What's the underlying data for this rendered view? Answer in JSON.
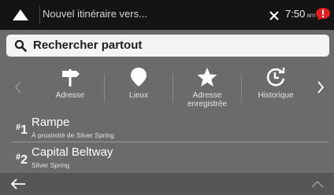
{
  "topbar": {
    "title": "Nouvel itinéraire vers...",
    "time": "7:50",
    "ampm": "am"
  },
  "search": {
    "label": "Rechercher partout"
  },
  "categories": [
    {
      "label": "Adresse",
      "icon": "signpost-icon"
    },
    {
      "label": "Lieux",
      "icon": "location-pin-icon"
    },
    {
      "label": "Adresse enregistrée",
      "icon": "star-icon"
    },
    {
      "label": "Historique",
      "icon": "history-icon"
    }
  ],
  "results": [
    {
      "rank": "1",
      "title": "Rampe",
      "subtitle": "À proximité de Silver Spring"
    },
    {
      "rank": "2",
      "title": "Capital Beltway",
      "subtitle": "Silver Spring"
    }
  ],
  "colors": {
    "background": "#6b6b6b",
    "topbar": "#141414",
    "message_badge": "#e02020"
  }
}
